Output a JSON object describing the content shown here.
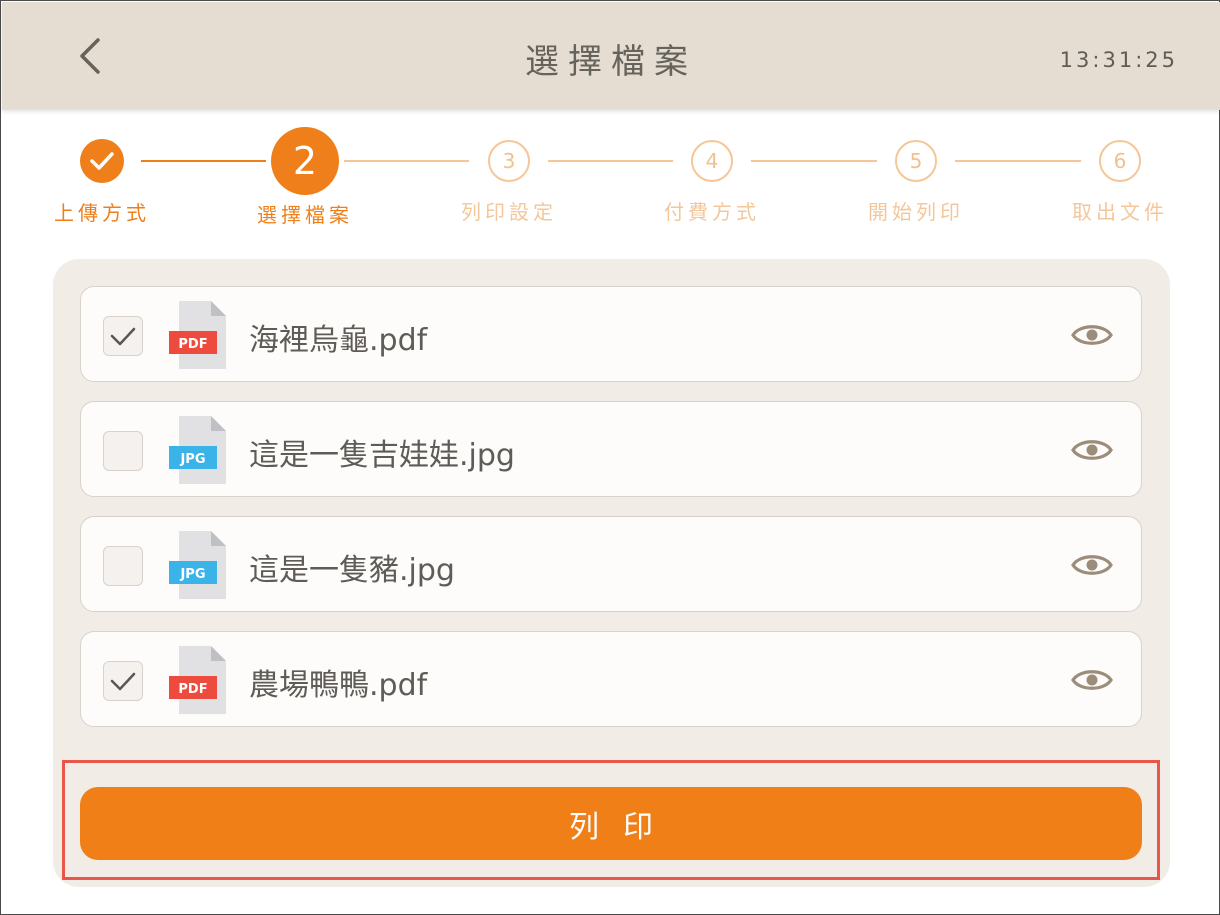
{
  "header": {
    "title": "選擇檔案",
    "time": "13:31:25",
    "back_icon": "chevron-left-icon"
  },
  "stepper": {
    "steps": [
      {
        "number": "1",
        "label": "上傳方式",
        "state": "done"
      },
      {
        "number": "2",
        "label": "選擇檔案",
        "state": "active"
      },
      {
        "number": "3",
        "label": "列印設定",
        "state": "pending"
      },
      {
        "number": "4",
        "label": "付費方式",
        "state": "pending"
      },
      {
        "number": "5",
        "label": "開始列印",
        "state": "pending"
      },
      {
        "number": "6",
        "label": "取出文件",
        "state": "pending"
      }
    ]
  },
  "files": [
    {
      "name": "海裡烏龜.pdf",
      "type": "PDF",
      "checked": true
    },
    {
      "name": "這是一隻吉娃娃.jpg",
      "type": "JPG",
      "checked": false
    },
    {
      "name": "這是一隻豬.jpg",
      "type": "JPG",
      "checked": false
    },
    {
      "name": "農場鴨鴨.pdf",
      "type": "PDF",
      "checked": true
    }
  ],
  "actions": {
    "print_label": "列印"
  },
  "colors": {
    "accent": "#ef7f1a",
    "accent_light": "#f5c697",
    "header_bg": "#e5ddd2",
    "panel_bg": "#f1ece6",
    "pdf_badge": "#ee4b3f",
    "jpg_badge": "#3ab3e8",
    "highlight": "#e8574a"
  }
}
